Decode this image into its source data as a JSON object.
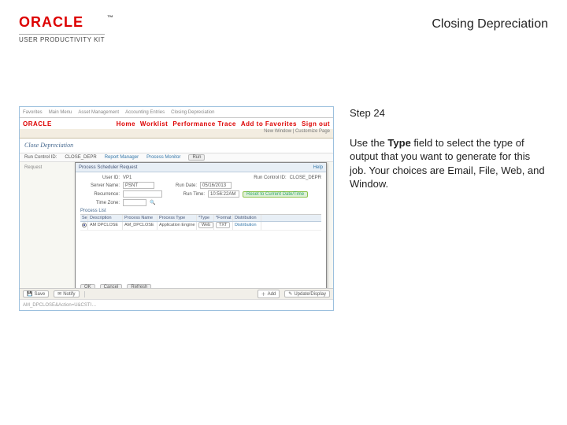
{
  "header": {
    "logo_text": "ORACLE",
    "upk_text": "USER PRODUCTIVITY KIT",
    "title": "Closing Depreciation"
  },
  "instruction": {
    "step_label": "Step 24",
    "text_before": "Use the ",
    "bold": "Type",
    "text_after": " field to select the type of output that you want to generate for this job. Your choices are Email, File, Web, and Window."
  },
  "app": {
    "topnav": [
      "Favorites",
      "Main Menu",
      "Asset Management",
      "Accounting Entries",
      "Closing Depreciation"
    ],
    "topright": [
      "Home",
      "Worklist",
      "Performance Trace",
      "Add to Favorites",
      "Sign out"
    ],
    "brand": "ORACLE",
    "subbar_right": "New Window | Customize Page",
    "page_title": "Close Depreciation",
    "strip": {
      "run_label": "Run Control ID:",
      "run_value": "CLOSE_DEPR",
      "report_label": "Report Manager",
      "process_label": "Process Monitor",
      "run_btn": "Run"
    },
    "panel_label": "Request",
    "modal": {
      "title": "Process Scheduler Request",
      "help": "Help",
      "rows": {
        "user_label": "User ID:",
        "user_value": "VP1",
        "runctl_label": "Run Control ID:",
        "runctl_value": "CLOSE_DEPR",
        "server_label": "Server Name:",
        "server_value": "PSNT",
        "rundate_label": "Run Date:",
        "rundate_value": "05/16/2013",
        "recurrence_label": "Recurrence:",
        "recurrence_value": "",
        "runtime_label": "Run Time:",
        "runtime_value": "10:56:22AM",
        "runtime_btn": "Reset to Current Date/Time",
        "timezone_label": "Time Zone:",
        "timezone_icon": "🔍"
      },
      "process_list_label": "Process List",
      "table": {
        "headers": [
          "Select",
          "Description",
          "Process Name",
          "Process Type",
          "*Type",
          "*Format",
          "Distribution"
        ],
        "row": {
          "selected": true,
          "description": "AM DPCLOSE",
          "process_name": "AM_DPCLOSE",
          "process_type": "Application Engine",
          "type": "Web",
          "format": "TXT",
          "distribution": "Distribution"
        }
      },
      "buttons": {
        "ok": "OK",
        "cancel": "Cancel",
        "refresh": "Refresh"
      }
    },
    "status": {
      "save": "Save",
      "notify": "Notify",
      "add": "Add",
      "update": "Update/Display"
    },
    "footer_left": "AM_DPCLOSE&Action=U&CSTI…",
    "footer_right": ""
  }
}
